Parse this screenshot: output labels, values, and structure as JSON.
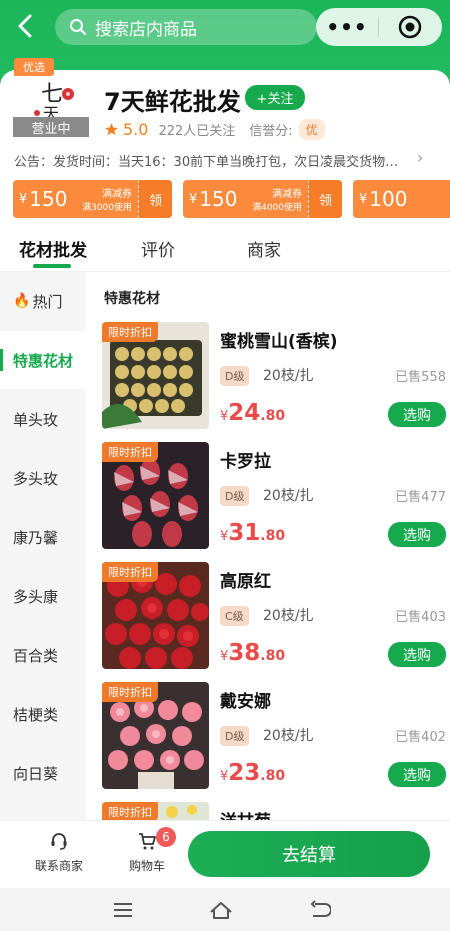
{
  "header": {
    "search_placeholder": "搜索店内商品",
    "menu_dots": "•••"
  },
  "shop": {
    "tag": "优选",
    "status": "营业中",
    "name": "7天鲜花批发",
    "follow_label": "+关注",
    "score": "5.0",
    "followers": "222人已关注",
    "credit_label": "信誉分:",
    "credit_value": "优",
    "notice": "公告：发货时间：当天16：30前下单当晚打包，次日凌晨交货物…",
    "logo_text_top": "七",
    "logo_text_bottom": "天"
  },
  "coupons": [
    {
      "currency": "¥",
      "amount": "150",
      "line1": "满减券",
      "line2": "满3000使用",
      "action": "领"
    },
    {
      "currency": "¥",
      "amount": "150",
      "line1": "满减券",
      "line2": "满4000使用",
      "action": "领"
    },
    {
      "currency": "¥",
      "amount": "100",
      "line1": "",
      "line2": "",
      "action": ""
    }
  ],
  "tabs": [
    "花材批发",
    "评价",
    "商家"
  ],
  "categories": [
    "热门",
    "特惠花材",
    "单头玫",
    "多头玫",
    "康乃馨",
    "多头康",
    "百合类",
    "桔梗类",
    "向日葵"
  ],
  "section_title": "特惠花材",
  "products": [
    {
      "badge": "限时折扣",
      "name": "蜜桃雪山(香槟)",
      "grade": "D级",
      "spec": "20枝/扎",
      "sold": "已售558",
      "currency": "¥",
      "price_int": "24",
      "price_dec": ".80",
      "buy": "选购"
    },
    {
      "badge": "限时折扣",
      "name": "卡罗拉",
      "grade": "D级",
      "spec": "20枝/扎",
      "sold": "已售477",
      "currency": "¥",
      "price_int": "31",
      "price_dec": ".80",
      "buy": "选购"
    },
    {
      "badge": "限时折扣",
      "name": "高原红",
      "grade": "C级",
      "spec": "20枝/扎",
      "sold": "已售403",
      "currency": "¥",
      "price_int": "38",
      "price_dec": ".80",
      "buy": "选购"
    },
    {
      "badge": "限时折扣",
      "name": "戴安娜",
      "grade": "D级",
      "spec": "20枝/扎",
      "sold": "已售402",
      "currency": "¥",
      "price_int": "23",
      "price_dec": ".80",
      "buy": "选购"
    },
    {
      "badge": "限时折扣",
      "name": "洋甘菊"
    }
  ],
  "bottom": {
    "contact_label": "联系商家",
    "cart_label": "购物车",
    "cart_count": "6",
    "checkout_label": "去结算"
  },
  "colors": {
    "brand_green": "#16a94e",
    "coupon_orange": "#fb8a3c",
    "price_red": "#e94b4b"
  }
}
